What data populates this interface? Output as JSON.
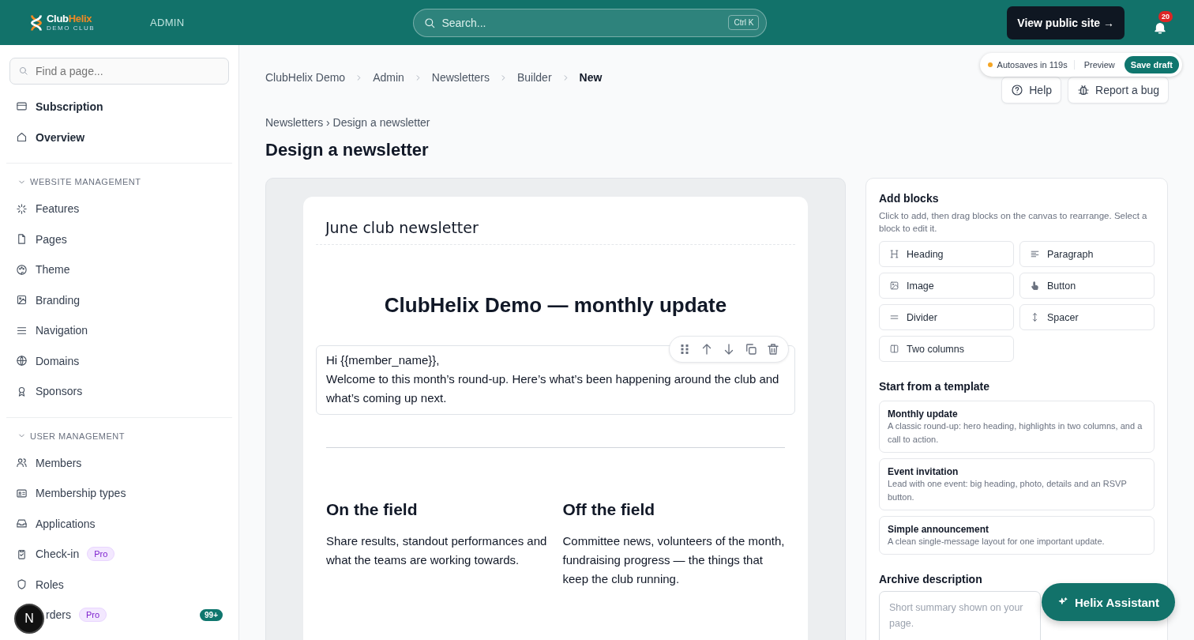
{
  "header": {
    "logo": {
      "first": "Club",
      "second": "Helix",
      "tagline": "DEMO CLUB"
    },
    "section_label": "ADMIN",
    "search": {
      "placeholder": "Search...",
      "shortcut": "Ctrl K"
    },
    "public_site_button": "View public site →",
    "notifications": {
      "count": "20"
    }
  },
  "sidebar": {
    "search": {
      "placeholder": "Find a page..."
    },
    "top_items": [
      {
        "label": "Subscription"
      },
      {
        "label": "Overview"
      }
    ],
    "sections": [
      {
        "title": "WEBSITE MANAGEMENT",
        "expanded": true,
        "items": [
          {
            "label": "Features"
          },
          {
            "label": "Pages"
          },
          {
            "label": "Theme"
          },
          {
            "label": "Branding"
          },
          {
            "label": "Navigation"
          },
          {
            "label": "Domains"
          },
          {
            "label": "Sponsors"
          }
        ]
      },
      {
        "title": "USER MANAGEMENT",
        "expanded": true,
        "items": [
          {
            "label": "Members"
          },
          {
            "label": "Membership types"
          },
          {
            "label": "Applications"
          },
          {
            "label": "Check-in",
            "badge": "Pro"
          },
          {
            "label": "Roles"
          },
          {
            "label": "rders",
            "badge": "Pro",
            "count": "99+",
            "covered": true
          }
        ]
      }
    ]
  },
  "dev_badge": "N",
  "main": {
    "breadcrumb": [
      {
        "label": "ClubHelix Demo",
        "current": false
      },
      {
        "label": "Admin",
        "current": false
      },
      {
        "label": "Newsletters",
        "current": false
      },
      {
        "label": "Builder",
        "current": false
      },
      {
        "label": "New",
        "current": true
      }
    ],
    "autosave": {
      "status": "Autosaves in 119s",
      "color": "#f5a524",
      "preview": "Preview",
      "save": "Save draft"
    },
    "help_button": "Help",
    "report_button": "Report a bug",
    "sub_breadcrumb": "Newsletters › Design a newsletter",
    "title": "Design a newsletter"
  },
  "canvas": {
    "subject": "June club newsletter",
    "blocks": [
      {
        "kind": "heading",
        "selected": false,
        "text": "ClubHelix Demo — monthly update"
      },
      {
        "kind": "paragraph",
        "selected": true,
        "lines": [
          "Hi {{member_name}},",
          "Welcome to this month’s round-up. Here’s what’s been happening around the club and what’s coming up next."
        ]
      },
      {
        "kind": "divider",
        "selected": false
      },
      {
        "kind": "columns",
        "selected": false,
        "columns": [
          {
            "heading": "On the field",
            "text": "Share results, standout performances and what the teams are working towards."
          },
          {
            "heading": "Off the field",
            "text": "Committee news, volunteers of the month, fundraising progress — the things that keep the club running."
          }
        ]
      }
    ]
  },
  "panel": {
    "add_blocks": {
      "title": "Add blocks",
      "hint": "Click to add, then drag blocks on the canvas to rearrange. Select a block to edit it.",
      "blocks": [
        "Heading",
        "Paragraph",
        "Image",
        "Button",
        "Divider",
        "Spacer",
        "Two columns"
      ]
    },
    "templates": {
      "title": "Start from a template",
      "items": [
        {
          "name": "Monthly update",
          "description": "A classic round-up: hero heading, highlights in two columns, and a call to action."
        },
        {
          "name": "Event invitation",
          "description": "Lead with one event: big heading, photo, details and an RSVP button."
        },
        {
          "name": "Simple announcement",
          "description": "A clean single-message layout for one important update."
        }
      ]
    },
    "archive": {
      "label": "Archive description",
      "placeholder": "Short summary shown on your\npage."
    }
  },
  "assistant_button": "Helix Assistant"
}
